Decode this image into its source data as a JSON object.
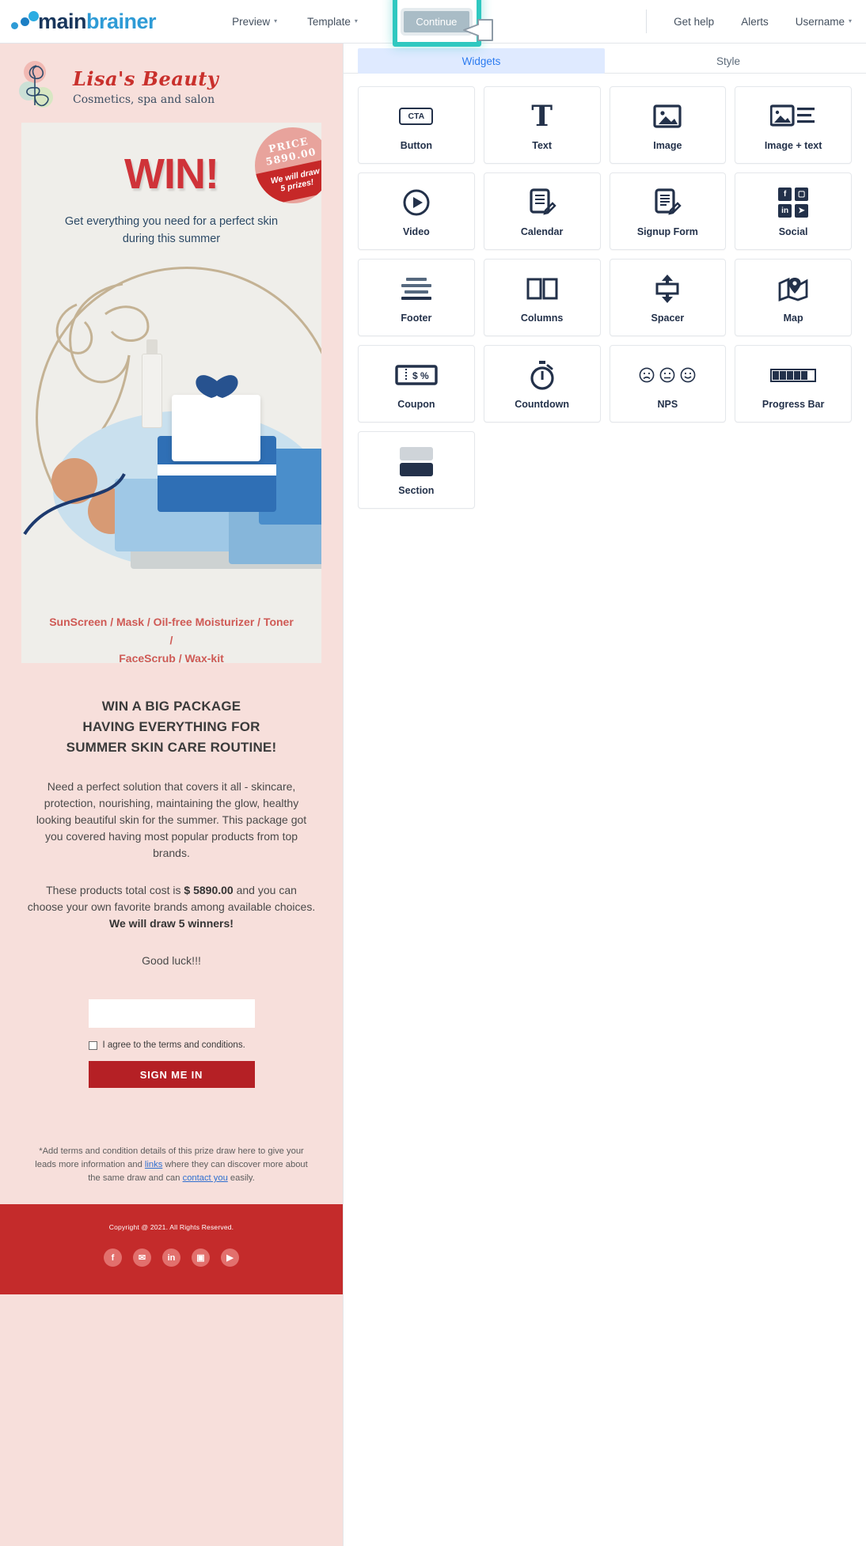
{
  "brand": {
    "name_part1": "main",
    "name_part2": "brainer"
  },
  "topnav": {
    "items": [
      {
        "label": "Preview",
        "has_caret": true
      },
      {
        "label": "Template",
        "has_caret": true
      }
    ],
    "continue_label": "Continue",
    "right_items": [
      {
        "label": "Get help",
        "has_caret": false
      },
      {
        "label": "Alerts",
        "has_caret": false
      },
      {
        "label": "Username",
        "has_caret": true
      }
    ],
    "caret_glyph": "▾"
  },
  "panel": {
    "tabs": [
      {
        "label": "Widgets",
        "active": true
      },
      {
        "label": "Style",
        "active": false
      }
    ],
    "widgets": [
      {
        "label": "Button",
        "icon": "cta-icon"
      },
      {
        "label": "Text",
        "icon": "text-t-icon"
      },
      {
        "label": "Image",
        "icon": "image-icon"
      },
      {
        "label": "Image + text",
        "icon": "image-text-icon"
      },
      {
        "label": "Video",
        "icon": "play-circle-icon"
      },
      {
        "label": "Calendar",
        "icon": "document-pencil-icon"
      },
      {
        "label": "Signup Form",
        "icon": "form-pencil-icon"
      },
      {
        "label": "Social",
        "icon": "social-networks-icon"
      },
      {
        "label": "Footer",
        "icon": "footer-lines-icon"
      },
      {
        "label": "Columns",
        "icon": "two-columns-icon"
      },
      {
        "label": "Spacer",
        "icon": "vertical-arrows-icon"
      },
      {
        "label": "Map",
        "icon": "map-pin-icon"
      },
      {
        "label": "Coupon",
        "icon": "coupon-ticket-icon"
      },
      {
        "label": "Countdown",
        "icon": "stopwatch-icon"
      },
      {
        "label": "NPS",
        "icon": "smiley-faces-icon"
      },
      {
        "label": "Progress Bar",
        "icon": "progress-bar-icon"
      },
      {
        "label": "Section",
        "icon": "section-blocks-icon"
      }
    ],
    "cta_text": "CTA",
    "text_glyph": "T",
    "social_icons": [
      "f",
      "▢",
      "in",
      "➤"
    ]
  },
  "email": {
    "brand_title": "Lisa's Beauty",
    "brand_sub": "Cosmetics, spa and salon",
    "badge": {
      "line1": "PRICE",
      "line2": "5890.00",
      "line3": "We will draw",
      "line4": "5 prizes!"
    },
    "headline": "WIN!",
    "subhead_line1": "Get everything you need for a perfect skin",
    "subhead_line2": "during this summer",
    "products_line1": "SunScreen / Mask / Oil-free Moisturizer / Toner /",
    "products_line2": "FaceScrub / Wax-kit",
    "section_head_line1": "WIN A BIG PACKAGE",
    "section_head_line2": "HAVING EVERYTHING FOR",
    "section_head_line3": "SUMMER SKIN CARE ROUTINE!",
    "paragraph1": "Need a perfect solution that covers it all - skincare, protection, nourishing, maintaining the glow, healthy looking beautiful skin for the summer. This package got you covered having most popular products from top brands.",
    "paragraph2_pre": "These products total cost is ",
    "paragraph2_price": "$ 5890.00",
    "paragraph2_mid": " and you can choose your own favorite brands among available choices. ",
    "paragraph2_bold": "We will draw 5 winners!",
    "goodluck": "Good luck!!!",
    "input_value": "",
    "input_placeholder": "",
    "agree_label": "I agree to the terms and conditions.",
    "signup_button": "SIGN ME IN",
    "terms_pre": "*Add terms and condition details of this prize draw here to give your leads more information and ",
    "terms_link1": "links",
    "terms_mid": " where they can discover more about the same draw and can ",
    "terms_link2": "contact you",
    "terms_post": " easily.",
    "copyright": "Copyright @ 2021. All Rights Reserved.",
    "social": [
      {
        "name": "facebook",
        "glyph": "f"
      },
      {
        "name": "twitter",
        "glyph": "✉"
      },
      {
        "name": "linkedin",
        "glyph": "in"
      },
      {
        "name": "instagram",
        "glyph": "▣"
      },
      {
        "name": "youtube",
        "glyph": "▶"
      }
    ]
  },
  "colors": {
    "accent_teal": "#2fc8c0",
    "brand_blue": "#2e9bd6",
    "brand_navy": "#18365c",
    "email_bg": "#f7dfdb",
    "email_red": "#c42b2b",
    "hero_bg": "#efeeea",
    "tab_active_bg": "#dfeaff"
  }
}
